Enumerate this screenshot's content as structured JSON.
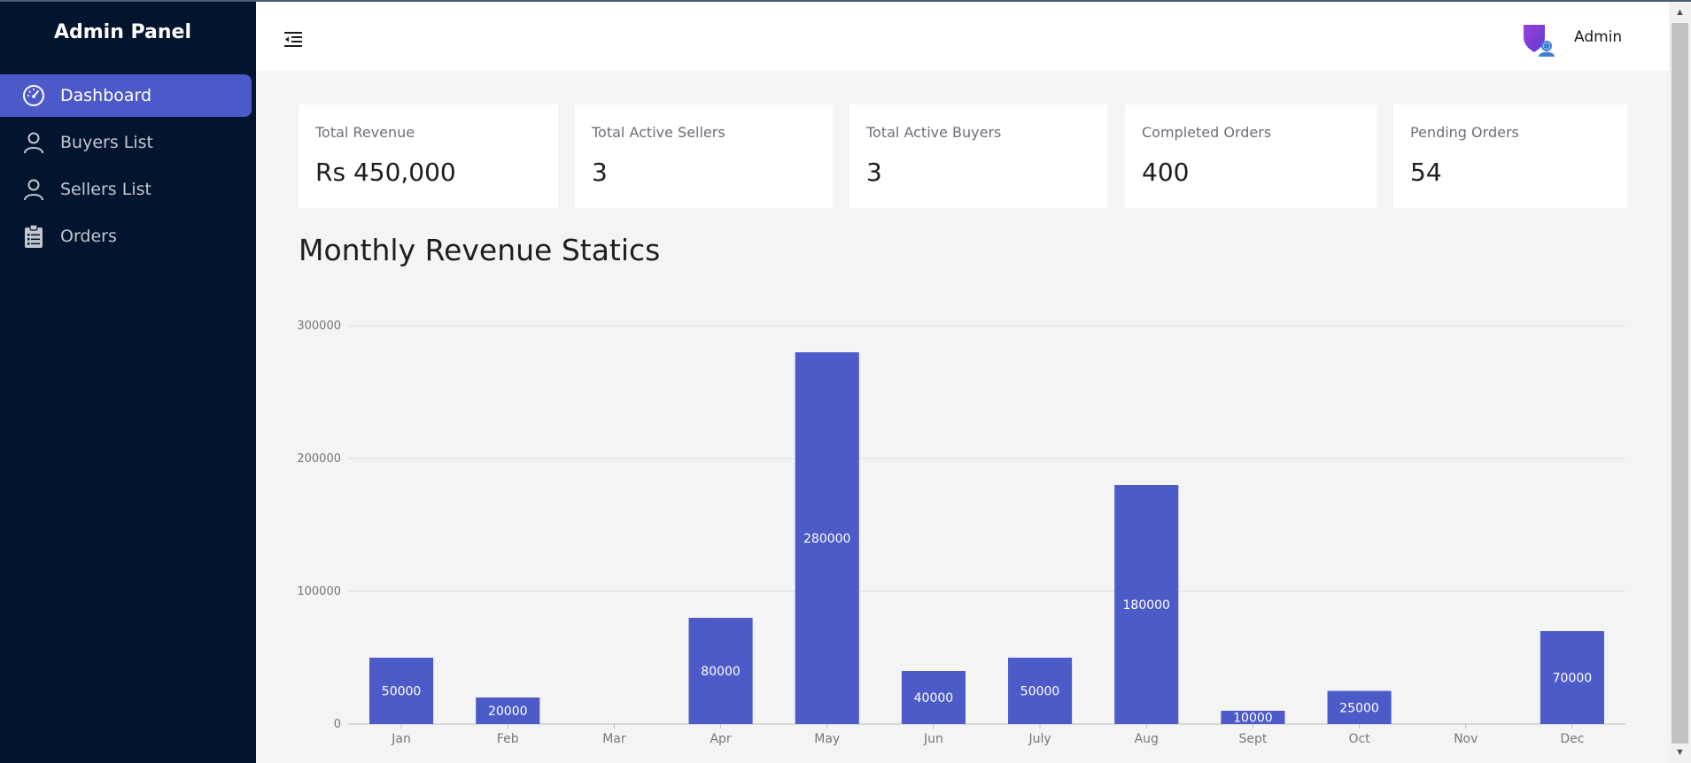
{
  "app": {
    "title": "Admin Panel"
  },
  "sidebar": {
    "items": [
      {
        "label": "Dashboard",
        "icon": "speedometer-icon",
        "active": true
      },
      {
        "label": "Buyers List",
        "icon": "user-icon",
        "active": false
      },
      {
        "label": "Sellers List",
        "icon": "user-icon",
        "active": false
      },
      {
        "label": "Orders",
        "icon": "clipboard-icon",
        "active": false
      }
    ]
  },
  "header": {
    "menu_icon": "menu-collapse-icon",
    "user_icon": "admin-shield-icon",
    "user_name": "Admin"
  },
  "cards": [
    {
      "label": "Total Revenue",
      "value": "Rs 450,000"
    },
    {
      "label": "Total Active Sellers",
      "value": "3"
    },
    {
      "label": "Total Active Buyers",
      "value": "3"
    },
    {
      "label": "Completed Orders",
      "value": "400"
    },
    {
      "label": "Pending Orders",
      "value": "54"
    }
  ],
  "colors": {
    "sidebar_bg": "#03142e",
    "accent": "#4c59c9",
    "bar": "#4c5bc7",
    "page_bg": "#f4f4f4"
  },
  "chart_data": {
    "type": "bar",
    "title": "Monthly Revenue Statics",
    "categories": [
      "Jan",
      "Feb",
      "Mar",
      "Apr",
      "May",
      "Jun",
      "July",
      "Aug",
      "Sept",
      "Oct",
      "Nov",
      "Dec"
    ],
    "values": [
      50000,
      20000,
      0,
      80000,
      280000,
      40000,
      50000,
      180000,
      10000,
      25000,
      0,
      70000
    ],
    "yticks": [
      0,
      100000,
      200000,
      300000
    ],
    "ylim": [
      0,
      300000
    ],
    "grid": true,
    "data_labels": true,
    "legend": "none"
  }
}
